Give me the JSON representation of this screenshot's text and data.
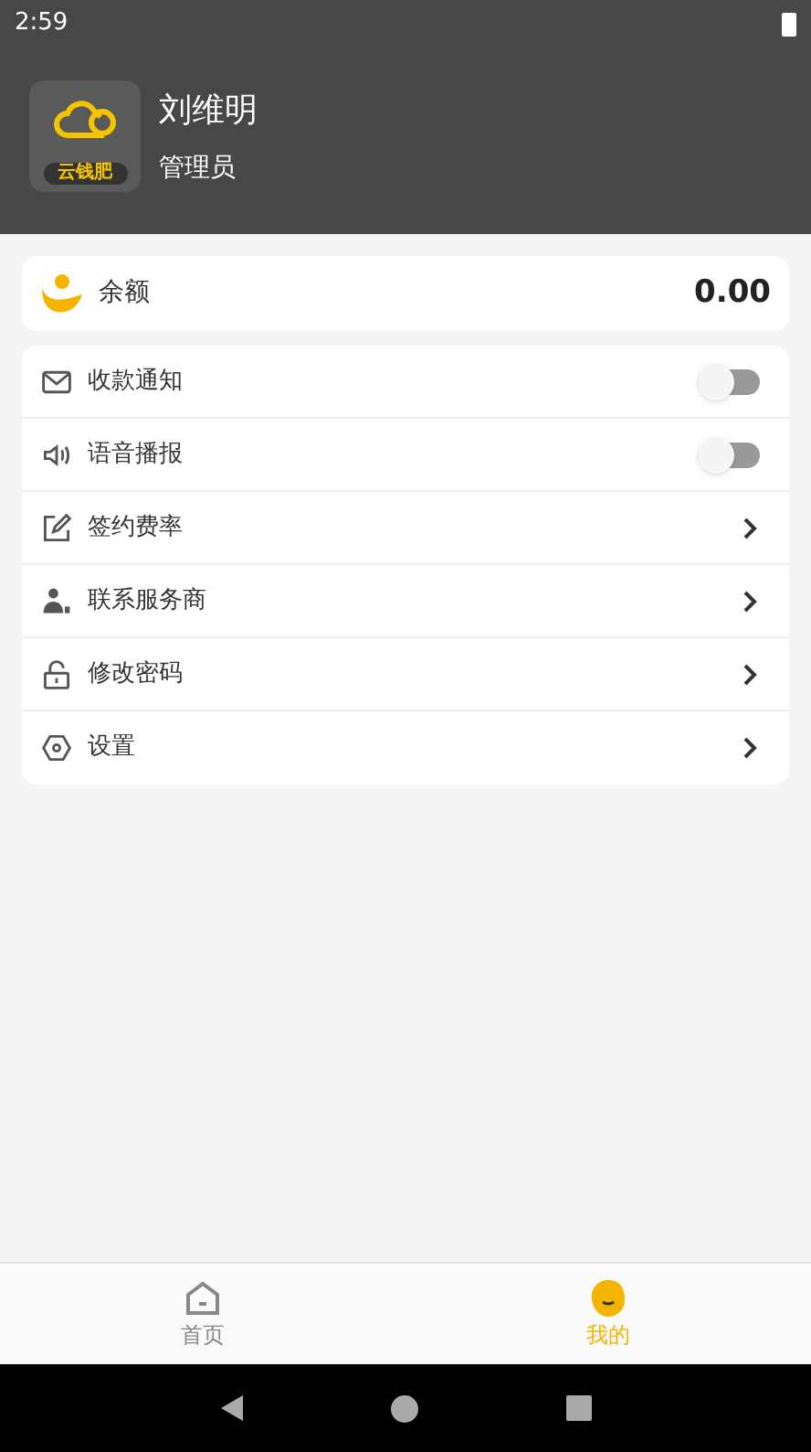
{
  "status_bar": {
    "time": "2:59"
  },
  "profile": {
    "logo_text": "云钱肥",
    "name": "刘维明",
    "role": "管理员"
  },
  "balance": {
    "label": "余额",
    "amount": "0.00"
  },
  "menu": [
    {
      "kind": "toggle",
      "label": "收款通知",
      "on": false
    },
    {
      "kind": "toggle",
      "label": "语音播报",
      "on": false
    },
    {
      "kind": "link",
      "label": "签约费率"
    },
    {
      "kind": "link",
      "label": "联系服务商"
    },
    {
      "kind": "link",
      "label": "修改密码"
    },
    {
      "kind": "link",
      "label": "设置"
    }
  ],
  "tab_bar": [
    {
      "label": "首页",
      "selected": false
    },
    {
      "label": "我的",
      "selected": true
    }
  ]
}
